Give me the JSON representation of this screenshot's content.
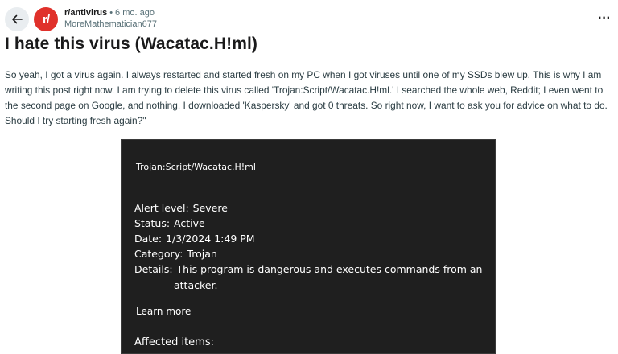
{
  "post": {
    "subreddit": "r/antivirus",
    "avatar_text": "r/",
    "age": "6 mo. ago",
    "author": "MoreMathematician677",
    "title": "I hate this virus (Wacatac.H!ml)",
    "body": "So yeah, I got a virus again. I always restarted and started fresh on my PC when I got viruses until one of my SSDs blew up. This is why I am writing this post right now. I am trying to delete this virus called 'Trojan:Script/Wacatac.H!ml.' I searched the whole web, Reddit; I even went to the second page on Google, and nothing. I downloaded 'Kaspersky' and got 0 threats. So right now, I want to ask you for advice on what to do. Should I try starting fresh again?\""
  },
  "defender": {
    "threat_name": "Trojan:Script/Wacatac.H!ml",
    "alert_level_label": "Alert level:",
    "alert_level": "Severe",
    "status_label": "Status:",
    "status": "Active",
    "date_label": "Date:",
    "date": "1/3/2024 1:49 PM",
    "category_label": "Category:",
    "category": "Trojan",
    "details_label": "Details:",
    "details_line1": "This program is dangerous and executes commands from an",
    "details_line2": "attacker.",
    "learn_more": "Learn more",
    "affected_items": "Affected items:"
  },
  "icons": {
    "back": "arrow-left-icon",
    "more": "more-horizontal-icon"
  },
  "colors": {
    "subreddit_avatar": "#e0312b",
    "defender_bg": "#1f1f1f"
  }
}
